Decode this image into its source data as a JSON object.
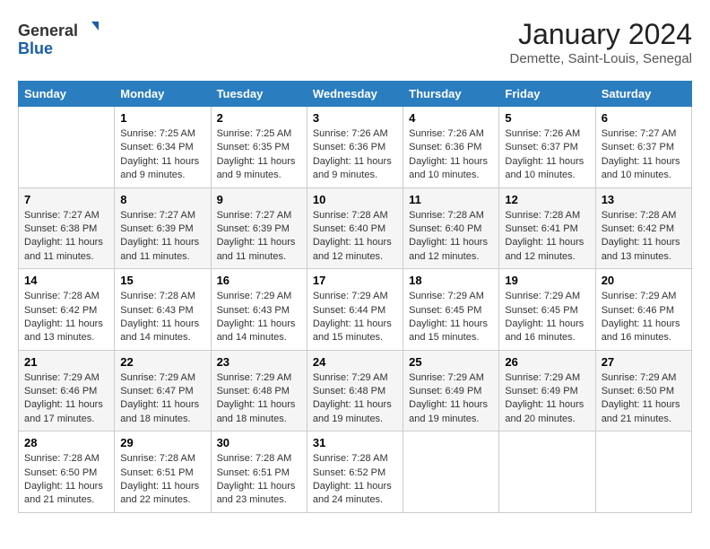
{
  "header": {
    "logo_line1": "General",
    "logo_line2": "Blue",
    "month_year": "January 2024",
    "location": "Demette, Saint-Louis, Senegal"
  },
  "weekdays": [
    "Sunday",
    "Monday",
    "Tuesday",
    "Wednesday",
    "Thursday",
    "Friday",
    "Saturday"
  ],
  "weeks": [
    [
      {
        "day": "",
        "sunrise": "",
        "sunset": "",
        "daylight": ""
      },
      {
        "day": "1",
        "sunrise": "Sunrise: 7:25 AM",
        "sunset": "Sunset: 6:34 PM",
        "daylight": "Daylight: 11 hours and 9 minutes."
      },
      {
        "day": "2",
        "sunrise": "Sunrise: 7:25 AM",
        "sunset": "Sunset: 6:35 PM",
        "daylight": "Daylight: 11 hours and 9 minutes."
      },
      {
        "day": "3",
        "sunrise": "Sunrise: 7:26 AM",
        "sunset": "Sunset: 6:36 PM",
        "daylight": "Daylight: 11 hours and 9 minutes."
      },
      {
        "day": "4",
        "sunrise": "Sunrise: 7:26 AM",
        "sunset": "Sunset: 6:36 PM",
        "daylight": "Daylight: 11 hours and 10 minutes."
      },
      {
        "day": "5",
        "sunrise": "Sunrise: 7:26 AM",
        "sunset": "Sunset: 6:37 PM",
        "daylight": "Daylight: 11 hours and 10 minutes."
      },
      {
        "day": "6",
        "sunrise": "Sunrise: 7:27 AM",
        "sunset": "Sunset: 6:37 PM",
        "daylight": "Daylight: 11 hours and 10 minutes."
      }
    ],
    [
      {
        "day": "7",
        "sunrise": "Sunrise: 7:27 AM",
        "sunset": "Sunset: 6:38 PM",
        "daylight": "Daylight: 11 hours and 11 minutes."
      },
      {
        "day": "8",
        "sunrise": "Sunrise: 7:27 AM",
        "sunset": "Sunset: 6:39 PM",
        "daylight": "Daylight: 11 hours and 11 minutes."
      },
      {
        "day": "9",
        "sunrise": "Sunrise: 7:27 AM",
        "sunset": "Sunset: 6:39 PM",
        "daylight": "Daylight: 11 hours and 11 minutes."
      },
      {
        "day": "10",
        "sunrise": "Sunrise: 7:28 AM",
        "sunset": "Sunset: 6:40 PM",
        "daylight": "Daylight: 11 hours and 12 minutes."
      },
      {
        "day": "11",
        "sunrise": "Sunrise: 7:28 AM",
        "sunset": "Sunset: 6:40 PM",
        "daylight": "Daylight: 11 hours and 12 minutes."
      },
      {
        "day": "12",
        "sunrise": "Sunrise: 7:28 AM",
        "sunset": "Sunset: 6:41 PM",
        "daylight": "Daylight: 11 hours and 12 minutes."
      },
      {
        "day": "13",
        "sunrise": "Sunrise: 7:28 AM",
        "sunset": "Sunset: 6:42 PM",
        "daylight": "Daylight: 11 hours and 13 minutes."
      }
    ],
    [
      {
        "day": "14",
        "sunrise": "Sunrise: 7:28 AM",
        "sunset": "Sunset: 6:42 PM",
        "daylight": "Daylight: 11 hours and 13 minutes."
      },
      {
        "day": "15",
        "sunrise": "Sunrise: 7:28 AM",
        "sunset": "Sunset: 6:43 PM",
        "daylight": "Daylight: 11 hours and 14 minutes."
      },
      {
        "day": "16",
        "sunrise": "Sunrise: 7:29 AM",
        "sunset": "Sunset: 6:43 PM",
        "daylight": "Daylight: 11 hours and 14 minutes."
      },
      {
        "day": "17",
        "sunrise": "Sunrise: 7:29 AM",
        "sunset": "Sunset: 6:44 PM",
        "daylight": "Daylight: 11 hours and 15 minutes."
      },
      {
        "day": "18",
        "sunrise": "Sunrise: 7:29 AM",
        "sunset": "Sunset: 6:45 PM",
        "daylight": "Daylight: 11 hours and 15 minutes."
      },
      {
        "day": "19",
        "sunrise": "Sunrise: 7:29 AM",
        "sunset": "Sunset: 6:45 PM",
        "daylight": "Daylight: 11 hours and 16 minutes."
      },
      {
        "day": "20",
        "sunrise": "Sunrise: 7:29 AM",
        "sunset": "Sunset: 6:46 PM",
        "daylight": "Daylight: 11 hours and 16 minutes."
      }
    ],
    [
      {
        "day": "21",
        "sunrise": "Sunrise: 7:29 AM",
        "sunset": "Sunset: 6:46 PM",
        "daylight": "Daylight: 11 hours and 17 minutes."
      },
      {
        "day": "22",
        "sunrise": "Sunrise: 7:29 AM",
        "sunset": "Sunset: 6:47 PM",
        "daylight": "Daylight: 11 hours and 18 minutes."
      },
      {
        "day": "23",
        "sunrise": "Sunrise: 7:29 AM",
        "sunset": "Sunset: 6:48 PM",
        "daylight": "Daylight: 11 hours and 18 minutes."
      },
      {
        "day": "24",
        "sunrise": "Sunrise: 7:29 AM",
        "sunset": "Sunset: 6:48 PM",
        "daylight": "Daylight: 11 hours and 19 minutes."
      },
      {
        "day": "25",
        "sunrise": "Sunrise: 7:29 AM",
        "sunset": "Sunset: 6:49 PM",
        "daylight": "Daylight: 11 hours and 19 minutes."
      },
      {
        "day": "26",
        "sunrise": "Sunrise: 7:29 AM",
        "sunset": "Sunset: 6:49 PM",
        "daylight": "Daylight: 11 hours and 20 minutes."
      },
      {
        "day": "27",
        "sunrise": "Sunrise: 7:29 AM",
        "sunset": "Sunset: 6:50 PM",
        "daylight": "Daylight: 11 hours and 21 minutes."
      }
    ],
    [
      {
        "day": "28",
        "sunrise": "Sunrise: 7:28 AM",
        "sunset": "Sunset: 6:50 PM",
        "daylight": "Daylight: 11 hours and 21 minutes."
      },
      {
        "day": "29",
        "sunrise": "Sunrise: 7:28 AM",
        "sunset": "Sunset: 6:51 PM",
        "daylight": "Daylight: 11 hours and 22 minutes."
      },
      {
        "day": "30",
        "sunrise": "Sunrise: 7:28 AM",
        "sunset": "Sunset: 6:51 PM",
        "daylight": "Daylight: 11 hours and 23 minutes."
      },
      {
        "day": "31",
        "sunrise": "Sunrise: 7:28 AM",
        "sunset": "Sunset: 6:52 PM",
        "daylight": "Daylight: 11 hours and 24 minutes."
      },
      {
        "day": "",
        "sunrise": "",
        "sunset": "",
        "daylight": ""
      },
      {
        "day": "",
        "sunrise": "",
        "sunset": "",
        "daylight": ""
      },
      {
        "day": "",
        "sunrise": "",
        "sunset": "",
        "daylight": ""
      }
    ]
  ]
}
